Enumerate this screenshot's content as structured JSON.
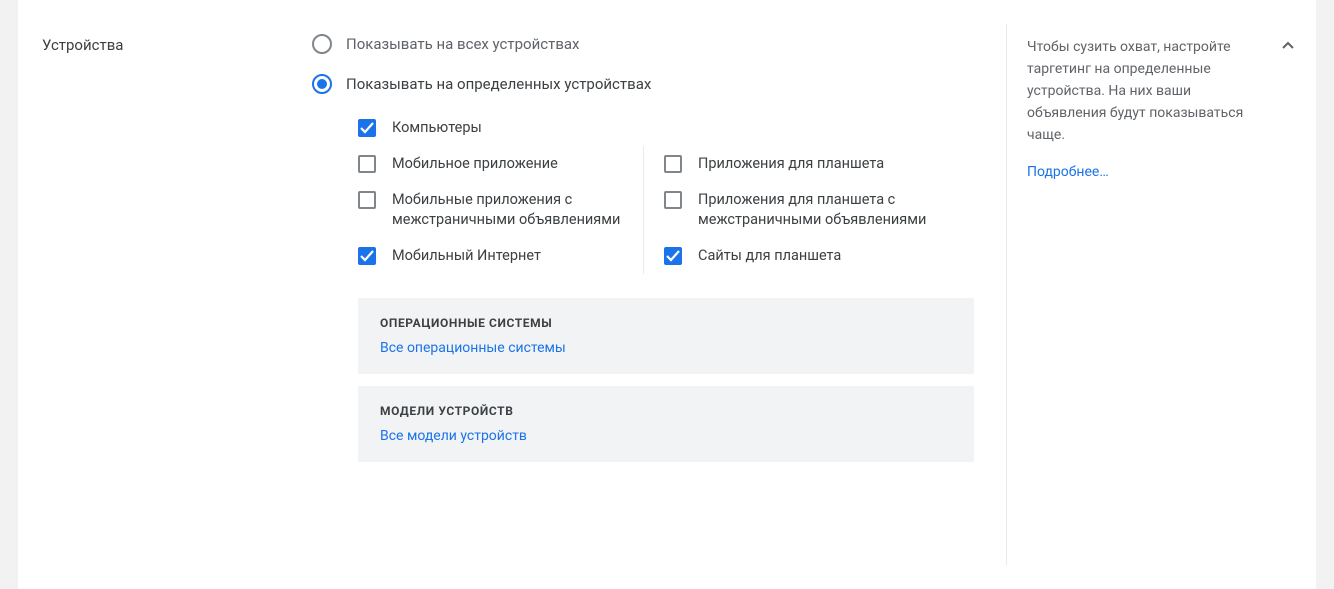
{
  "section_title": "Устройства",
  "radio": {
    "all": "Показывать на всех устройствах",
    "specific": "Показывать на определенных устройствах"
  },
  "checkboxes": {
    "left": [
      {
        "label": "Компьютеры",
        "checked": true
      },
      {
        "label": "Мобильное приложение",
        "checked": false
      },
      {
        "label": "Мобильные приложения с межстраничными объявлениями",
        "checked": false
      },
      {
        "label": "Мобильный Интернет",
        "checked": true
      }
    ],
    "right": [
      {
        "label": "Приложения для планшета",
        "checked": false
      },
      {
        "label": "Приложения для планшета с межстраничными объявлениями",
        "checked": false
      },
      {
        "label": "Сайты для планшета",
        "checked": true
      }
    ]
  },
  "os_box": {
    "title": "ОПЕРАЦИОННЫЕ СИСТЕМЫ",
    "link": "Все операционные системы"
  },
  "models_box": {
    "title": "МОДЕЛИ УСТРОЙСТВ",
    "link": "Все модели устройств"
  },
  "help": {
    "text": "Чтобы сузить охват, настройте таргетинг на определенные устройства. На них ваши объявления будут показываться чаще.",
    "more": "Подробнее…"
  }
}
